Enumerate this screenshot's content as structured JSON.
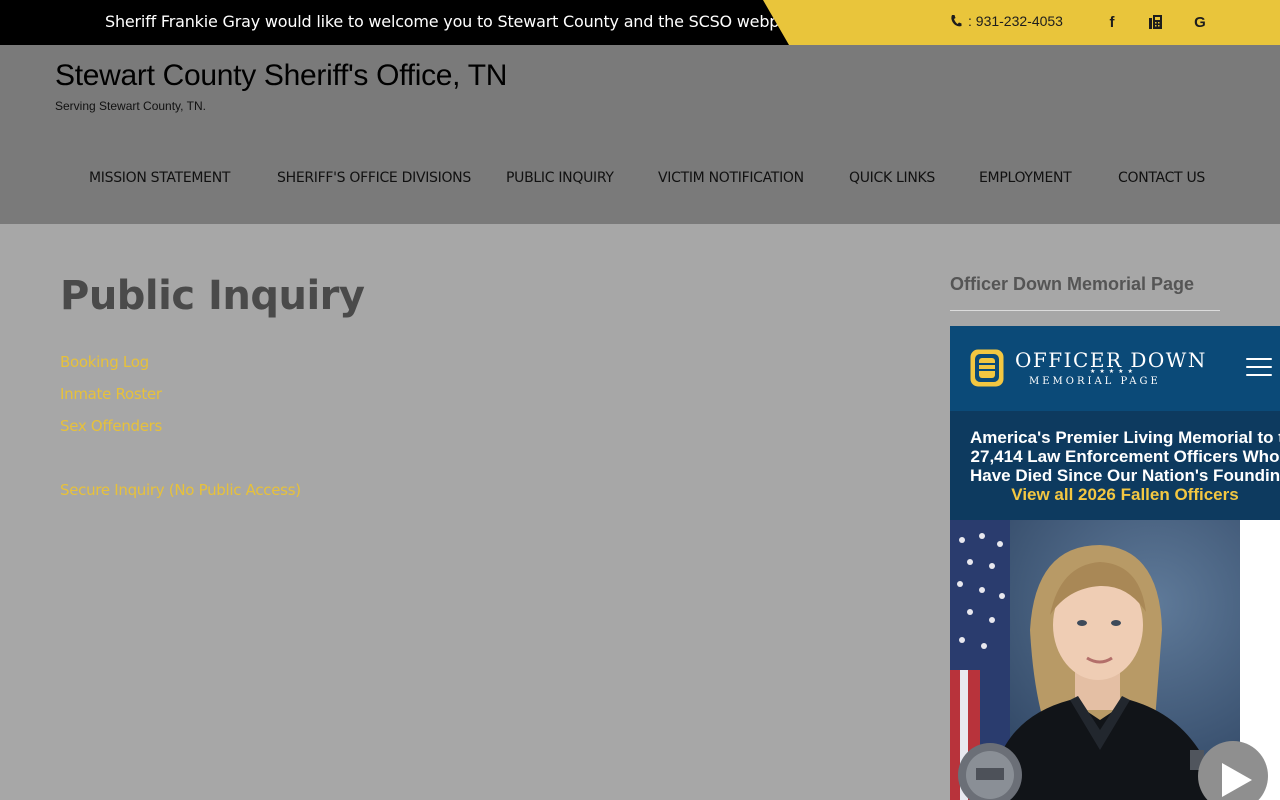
{
  "topbar": {
    "welcome": "Sheriff Frankie Gray would like to welcome you to Stewart County and the SCSO webpage",
    "phone": ": 931-232-4053",
    "social": [
      {
        "icon": "facebook-icon",
        "label": "f"
      },
      {
        "icon": "fax-icon"
      },
      {
        "icon": "google-icon",
        "label": "G"
      }
    ],
    "accent_color": "#e9c53b"
  },
  "header": {
    "title": "Stewart County Sheriff's Office, TN",
    "tagline": "Serving Stewart County, TN."
  },
  "nav": {
    "items": [
      {
        "label": "MISSION STATEMENT"
      },
      {
        "label": "SHERIFF'S OFFICE DIVISIONS"
      },
      {
        "label": "PUBLIC INQUIRY"
      },
      {
        "label": "VICTIM NOTIFICATION"
      },
      {
        "label": "QUICK LINKS"
      },
      {
        "label": "EMPLOYMENT"
      },
      {
        "label": "CONTACT US"
      }
    ]
  },
  "main": {
    "title": "Public Inquiry",
    "links": [
      {
        "label": "Booking Log"
      },
      {
        "label": "Inmate Roster"
      },
      {
        "label": "Sex Offenders"
      },
      {
        "label": "Secure Inquiry (No Public Access)"
      }
    ],
    "link_color": "#e7c13a"
  },
  "sidebar": {
    "widget_title": "Officer Down Memorial Page",
    "odmp": {
      "logo_line1": "OFFICER DOWN",
      "logo_line2": "MEMORIAL PAGE",
      "banner_lines": [
        "America's Premier Living Memorial to the",
        "27,414 Law Enforcement Officers Who",
        "Have Died Since Our Nation's Founding -"
      ],
      "banner_cta": "View all 2026 Fallen Officers",
      "brand_color": "#0b4a78"
    }
  }
}
